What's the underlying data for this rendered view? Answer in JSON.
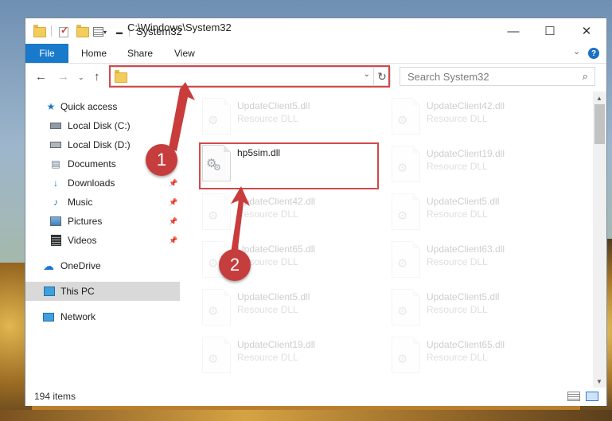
{
  "window": {
    "title": "System32",
    "controls": {
      "minimize": "—",
      "maximize": "☐",
      "close": "✕"
    }
  },
  "ribbon": {
    "file": "File",
    "tabs": [
      "Home",
      "Share",
      "View"
    ],
    "help": "?"
  },
  "address": {
    "path": "C:\\Windows\\System32",
    "search_placeholder": "Search System32"
  },
  "sidebar": {
    "items": [
      {
        "label": "Quick access",
        "icon": "star-icon",
        "pinned": false
      },
      {
        "label": "Local Disk (C:)",
        "icon": "drive-icon",
        "pinned": false
      },
      {
        "label": "Local Disk (D:)",
        "icon": "drive-icon",
        "pinned": false
      },
      {
        "label": "Documents",
        "icon": "documents-icon",
        "pinned": true
      },
      {
        "label": "Downloads",
        "icon": "download-icon",
        "pinned": true
      },
      {
        "label": "Music",
        "icon": "music-icon",
        "pinned": true
      },
      {
        "label": "Pictures",
        "icon": "pictures-icon",
        "pinned": true
      },
      {
        "label": "Videos",
        "icon": "videos-icon",
        "pinned": true
      },
      {
        "label": "OneDrive",
        "icon": "cloud-icon",
        "pinned": false
      },
      {
        "label": "This PC",
        "icon": "computer-icon",
        "pinned": false,
        "selected": true
      },
      {
        "label": "Network",
        "icon": "network-icon",
        "pinned": false
      }
    ]
  },
  "files": {
    "highlighted": {
      "name": "hp5sim.dll",
      "type": ""
    },
    "left_column": [
      {
        "name": "UpdateClient5.dll",
        "type": "Resource DLL"
      },
      {
        "name": "UpdateClient42.dll",
        "type": "Resource DLL"
      },
      {
        "name": "UpdateClient65.dll",
        "type": "Resource DLL"
      },
      {
        "name": "UpdateClient5.dll",
        "type": "Resource DLL"
      },
      {
        "name": "UpdateClient19.dll",
        "type": "Resource DLL"
      }
    ],
    "right_column": [
      {
        "name": "UpdateClient42.dll",
        "type": "Resource DLL"
      },
      {
        "name": "UpdateClient19.dll",
        "type": "Resource DLL"
      },
      {
        "name": "UpdateClient5.dll",
        "type": "Resource DLL"
      },
      {
        "name": "UpdateClient63.dll",
        "type": "Resource DLL"
      },
      {
        "name": "UpdateClient5.dll",
        "type": "Resource DLL"
      },
      {
        "name": "UpdateClient65.dll",
        "type": "Resource DLL"
      }
    ]
  },
  "status": {
    "item_count": "194 items"
  },
  "annotations": {
    "step1": "1",
    "step2": "2",
    "accent_color": "#d24a4a"
  }
}
